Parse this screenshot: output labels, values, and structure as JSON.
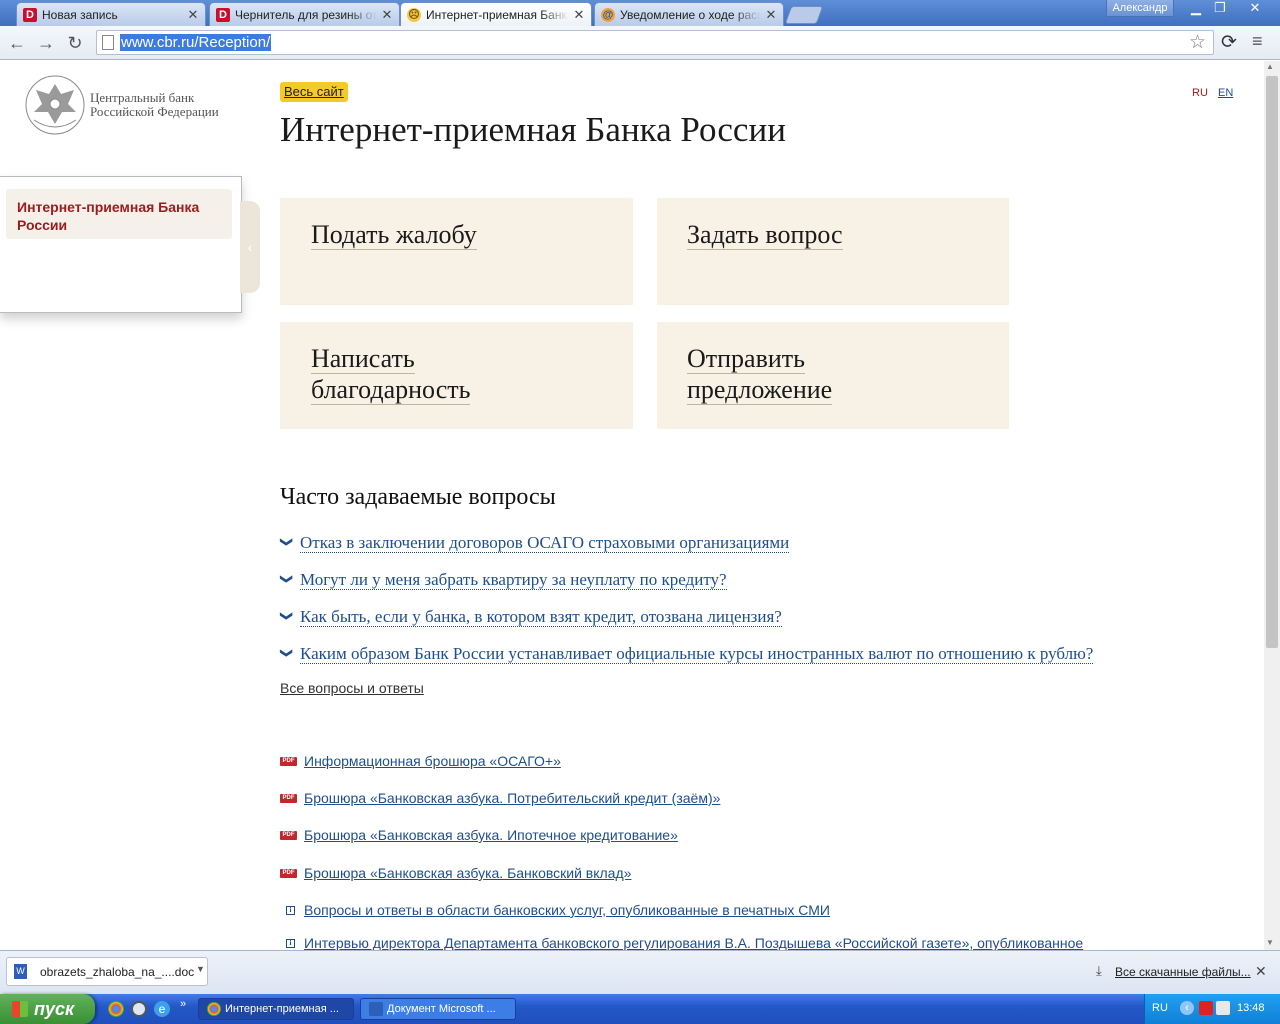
{
  "browser": {
    "tabs": [
      {
        "title": "Новая запись",
        "favicon": "D"
      },
      {
        "title": "Чернитель для резины от с",
        "favicon": "D"
      },
      {
        "title": "Интернет-приемная Банка Р",
        "favicon": "cbr"
      },
      {
        "title": "Уведомление о ходе рассм",
        "favicon": "mail"
      }
    ],
    "profile_name": "Александр",
    "url": "www.cbr.ru/Reception/"
  },
  "page": {
    "logo_line1": "Центральный банк",
    "logo_line2": "Российской Федерации",
    "all_site": "Весь сайт",
    "lang_ru": "RU",
    "lang_en": "EN",
    "title": "Интернет-приемная Банка России",
    "sidebar_item": "Интернет-приемная Банка России",
    "cards": [
      {
        "line1": "Подать жалобу",
        "line2": ""
      },
      {
        "line1": "Задать вопрос",
        "line2": ""
      },
      {
        "line1": "Написать",
        "line2": "благодарность"
      },
      {
        "line1": "Отправить",
        "line2": "предложение"
      }
    ],
    "faq_title": "Часто задаваемые вопросы",
    "faq": [
      "Отказ в заключении договоров ОСАГО страховыми организациями",
      "Могут ли у меня забрать квартиру за неуплату по кредиту?",
      "Как быть, если у банка, в котором взят кредит, отозвана лицензия?",
      "Каким образом Банк России устанавливает официальные курсы иностранных валют по отношению к рублю?"
    ],
    "all_qa": "Все вопросы и ответы",
    "docs": [
      {
        "icon": "pdf",
        "label": "Информационная брошюра «ОСАГО+»"
      },
      {
        "icon": "pdf",
        "label": "Брошюра «Банковская азбука. Потребительский кредит (заём)»"
      },
      {
        "icon": "pdf",
        "label": "Брошюра «Банковская азбука. Ипотечное кредитование»"
      },
      {
        "icon": "pdf",
        "label": "Брошюра «Банковская азбука. Банковский вклад»"
      },
      {
        "icon": "info",
        "label": "Вопросы и ответы в области банковских услуг, опубликованные в печатных СМИ"
      },
      {
        "icon": "info",
        "label": "Интервью директора Департамента банковского регулирования В.А. Поздышева «Российской газете», опубликованное"
      }
    ],
    "pdf_badge": "PDF"
  },
  "downloads": {
    "file": "obrazets_zhaloba_na_....doc",
    "show_all": "Все скачанные файлы..."
  },
  "taskbar": {
    "start": "пуск",
    "tasks": [
      "Интернет-приемная ...",
      "Документ Microsoft ..."
    ],
    "lang": "RU",
    "clock": "13:48"
  }
}
